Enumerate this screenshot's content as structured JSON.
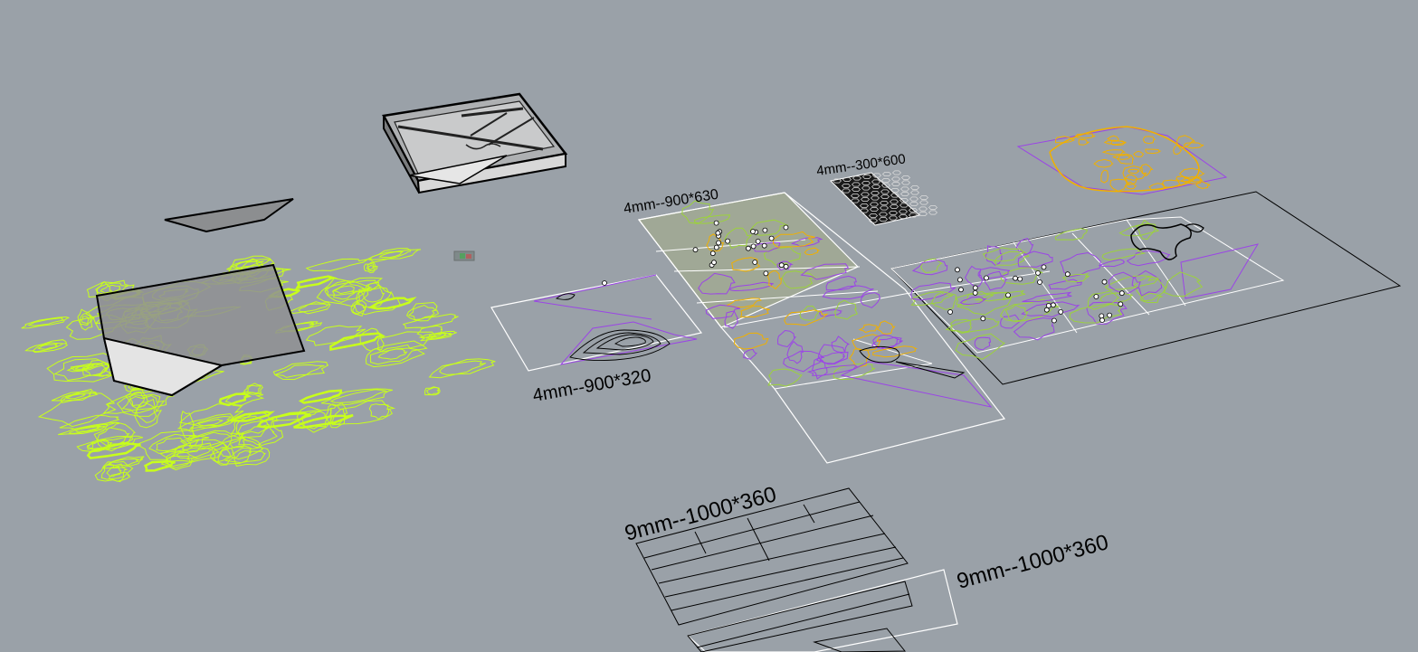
{
  "viewport": {
    "background": "#9aa1a8",
    "colors": {
      "lime": "#c8ff1a",
      "green": "#9cd23c",
      "purple": "#9b45e6",
      "orange": "#f0b000",
      "white": "#ffffff",
      "black": "#000000",
      "grey_fill": "#8d8f91",
      "light_fill": "#dcdcdc"
    }
  },
  "labels": {
    "sheet_900x630": "4mm--900*630",
    "sheet_300x600": "4mm--300*600",
    "sheet_900x320": "4mm--900*320",
    "sheet_1000x360_a": "9mm--1000*360",
    "sheet_1000x360_b": "9mm--1000*360"
  },
  "icons": {
    "small_object": "small-model-icon"
  }
}
